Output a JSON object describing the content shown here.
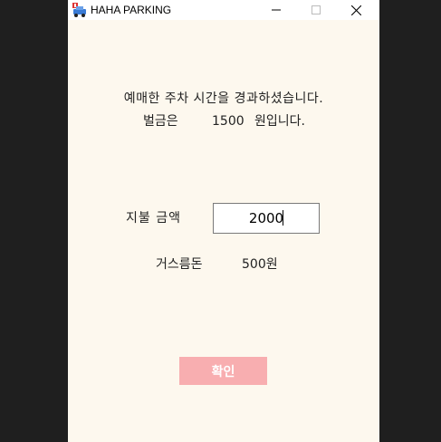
{
  "window": {
    "title": "HAHA PARKING",
    "controls": {
      "minimize": "minimize",
      "maximize": "maximize",
      "close": "close"
    },
    "icon": "car-parking-icon"
  },
  "message": {
    "line1": "예매한 주차 시간을 경과하셨습니다.",
    "fine_label": "벌금은",
    "fine_amount": "1500",
    "fine_suffix": "원입니다."
  },
  "payment": {
    "label": "지불 금액",
    "value": "2000"
  },
  "change": {
    "label": "거스름돈",
    "value": "500원"
  },
  "confirm": {
    "label": "확인"
  },
  "colors": {
    "background": "#fdf8ee",
    "button": "#f8aeb0",
    "outer": "#1f1f1f"
  }
}
